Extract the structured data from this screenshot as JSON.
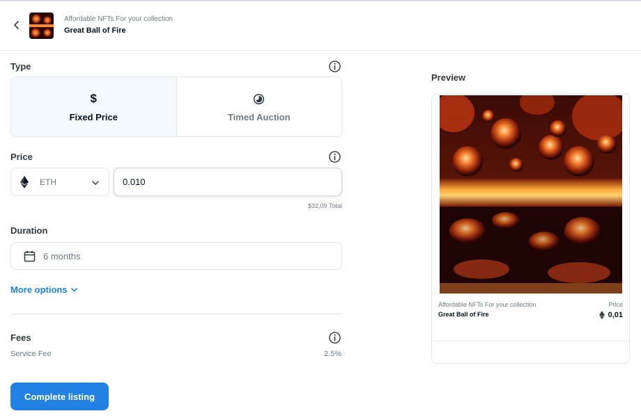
{
  "header": {
    "collection": "Affordable NFTs For your collection",
    "item_name": "Great Ball of Fire"
  },
  "type_section": {
    "label": "Type",
    "options": [
      {
        "label": "Fixed Price",
        "icon": "dollar-icon",
        "selected": true
      },
      {
        "label": "Timed Auction",
        "icon": "clock-icon",
        "selected": false
      }
    ]
  },
  "price_section": {
    "label": "Price",
    "currency": "ETH",
    "amount": "0.010",
    "total": "$32,09 Total"
  },
  "duration_section": {
    "label": "Duration",
    "value": "6 months"
  },
  "more_options": "More options",
  "fees_section": {
    "label": "Fees",
    "service_fee_label": "Service Fee",
    "service_fee_value": "2.5%"
  },
  "complete_button": "Complete listing",
  "preview": {
    "title": "Preview",
    "collection": "Affordable NFTs For your collection",
    "item_name": "Great Ball of Fire",
    "price_label": "Price",
    "price": "0,01"
  },
  "colors": {
    "accent": "#2081e2",
    "text_primary": "#04111d",
    "text_secondary": "#707a83",
    "border": "#e5e8eb",
    "selected_bg": "#f4f9fd"
  }
}
